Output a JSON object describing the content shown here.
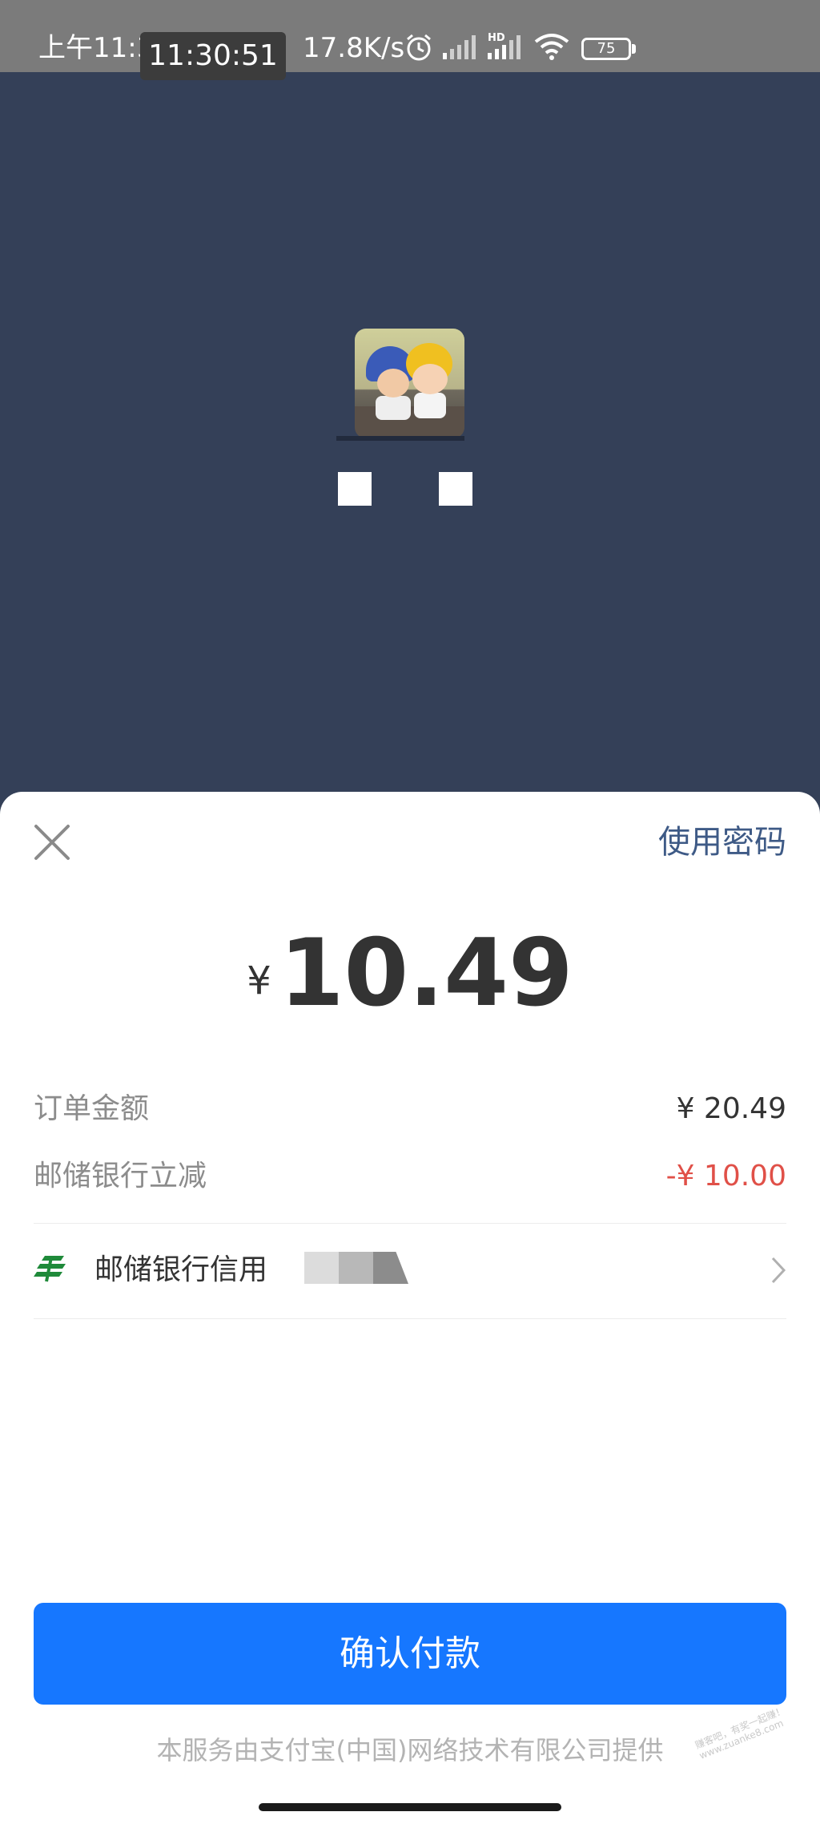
{
  "status_bar": {
    "time": "上午11:30",
    "time_overlay": "11:30:51",
    "net_speed": "17.8K/s",
    "hd_label": "HD",
    "battery": "75"
  },
  "merchant": {
    "masked_name_blocks": 2
  },
  "sheet": {
    "use_password_label": "使用密码",
    "amount": {
      "currency": "¥",
      "value": "10.49"
    },
    "details": [
      {
        "label": "订单金额",
        "value": "¥ 20.49"
      },
      {
        "label": "邮储银行立减",
        "value": "-¥ 10.00"
      }
    ],
    "payment_method": {
      "bank_name": "邮储银行信用"
    },
    "confirm_label": "确认付款",
    "provider_note": "本服务由支付宝(中国)网络技术有限公司提供",
    "watermark": "赚客吧，有奖一起赚！ www.zuanke8.com"
  },
  "colors": {
    "header_background": "#344058",
    "primary_button": "#1677ff",
    "discount_text": "#e05048",
    "link_text": "#3e5a86",
    "bank_icon": "#1f8a3a"
  }
}
